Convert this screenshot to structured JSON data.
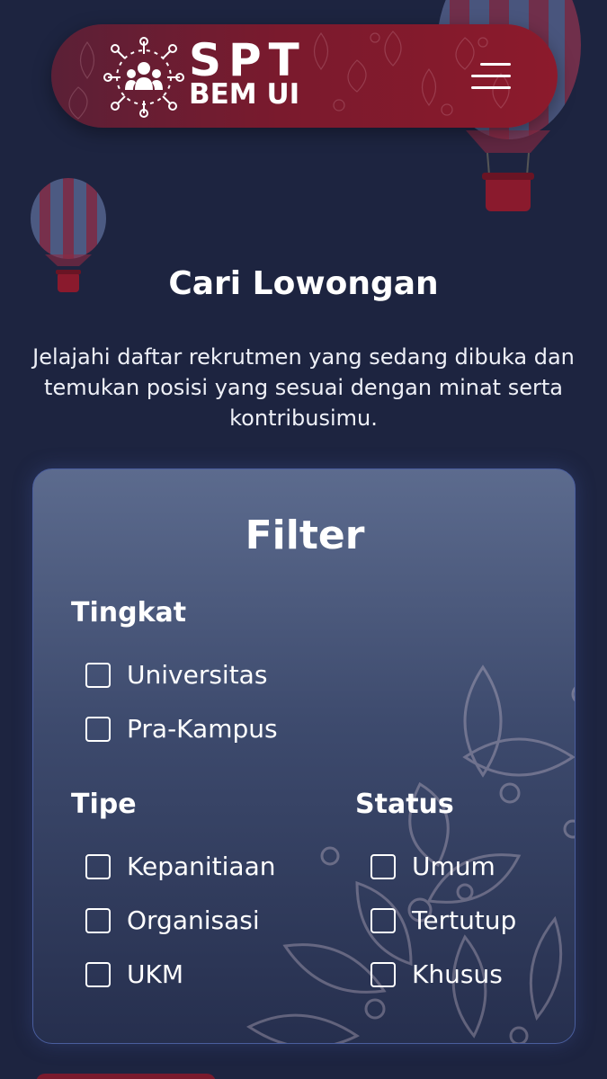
{
  "colors": {
    "background": "#1d2440",
    "navbar_accent": "#8c1a2c",
    "card_border": "#4a5e9e",
    "text": "#ffffff"
  },
  "header": {
    "logo_title": "SPT",
    "logo_subtitle": "BEM UI",
    "logo_icon": "people-network-icon",
    "menu_icon": "hamburger-menu-icon"
  },
  "hero": {
    "title": "Cari Lowongan",
    "description": "Jelajahi daftar rekrutmen yang sedang dibuka dan temukan posisi yang sesuai dengan minat serta kontribusimu."
  },
  "filter": {
    "title": "Filter",
    "tingkat": {
      "label": "Tingkat",
      "options": [
        "Universitas",
        "Pra-Kampus"
      ]
    },
    "tipe": {
      "label": "Tipe",
      "options": [
        "Kepanitiaan",
        "Organisasi",
        "UKM"
      ]
    },
    "status": {
      "label": "Status",
      "options": [
        "Umum",
        "Tertutup",
        "Khusus"
      ]
    }
  }
}
